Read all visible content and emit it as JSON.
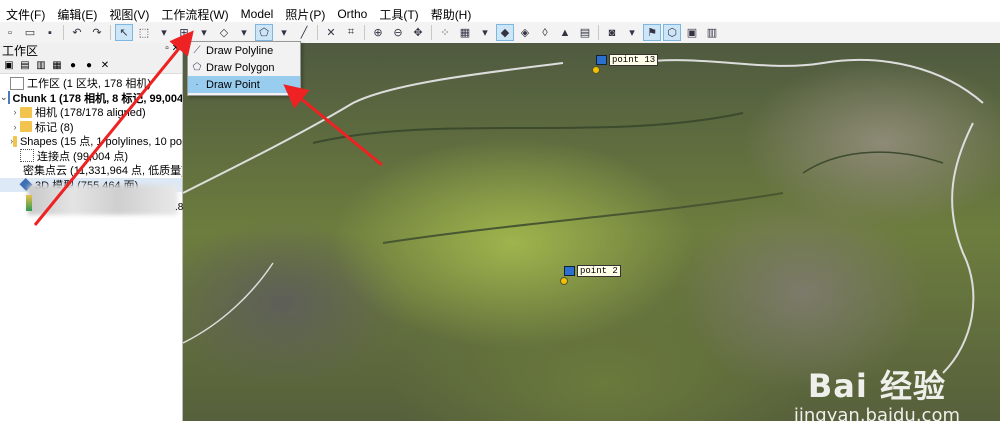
{
  "menu": [
    "文件(F)",
    "编辑(E)",
    "视图(V)",
    "工作流程(W)",
    "Model",
    "照片(P)",
    "Ortho",
    "工具(T)",
    "帮助(H)"
  ],
  "panel": {
    "title": "工作区",
    "tree": [
      {
        "label": "工作区 (1 区块, 178 相机)",
        "indent": 0
      },
      {
        "label": "Chunk 1 (178 相机, 8 标记, 99,004 点",
        "indent": 1,
        "bold": true
      },
      {
        "label": "相机 (178/178 aligned)",
        "indent": 2
      },
      {
        "label": "标记 (8)",
        "indent": 2
      },
      {
        "label": "Shapes (15 点, 1 polylines, 10 po",
        "indent": 2
      },
      {
        "label": "连接点 (99,004 点)",
        "indent": 2
      },
      {
        "label": "密集点云 (11,331,964 点, 低质量)",
        "indent": 2
      },
      {
        "label": "3D 模型 (755,464 面)",
        "indent": 2
      }
    ],
    "blurred_suffix": ".8"
  },
  "dropdown": {
    "items": [
      "Draw Polyline",
      "Draw Polygon",
      "Draw Point"
    ],
    "highlighted": 2
  },
  "markers": [
    "point 13",
    "point 2"
  ],
  "watermark": {
    "line1": "Bai 经验",
    "line2": "jingyan.baidu.com"
  },
  "colors": {
    "highlight": "#99cdf0",
    "arrow": "#ee2222"
  }
}
